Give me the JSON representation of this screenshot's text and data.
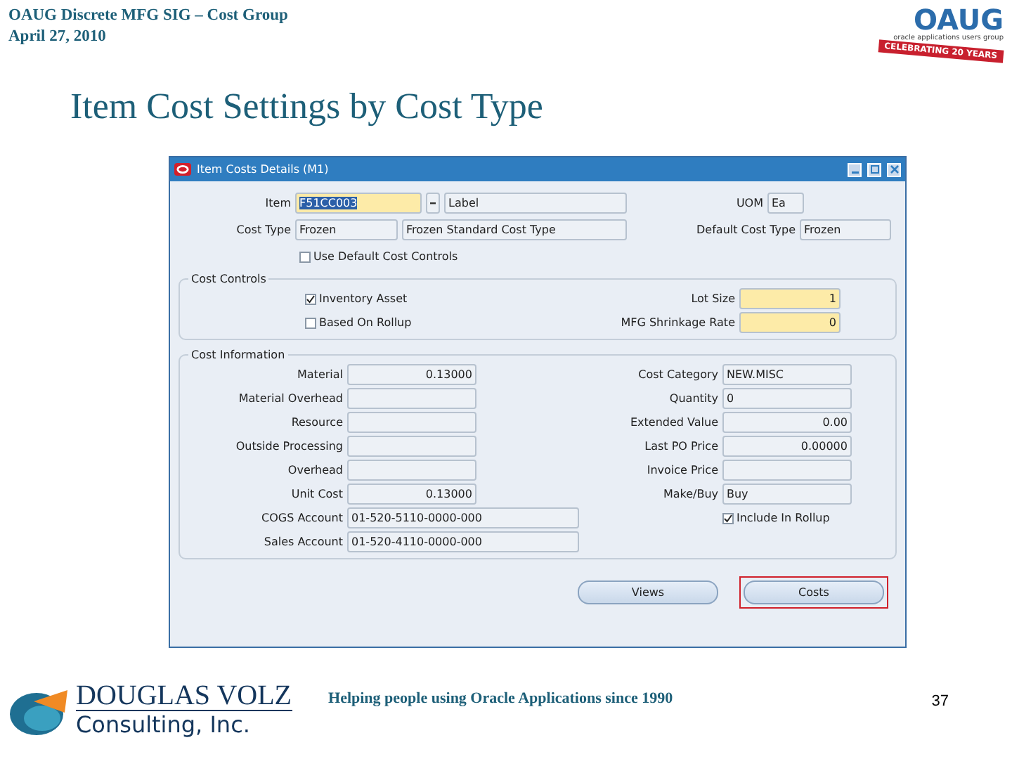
{
  "slide_header": {
    "line": "OAUG Discrete MFG SIG – Cost Group",
    "date": "April 27, 2010"
  },
  "oaug_logo": {
    "name": "OAUG",
    "tagline": "oracle applications users group",
    "banner": "CELEBRATING 20 YEARS"
  },
  "slide_title": "Item Cost Settings by Cost Type",
  "window": {
    "title": "Item Costs Details (M1)",
    "item": {
      "label": "Item",
      "value": "F51CC003",
      "required": true,
      "text_selected": true,
      "description": "Label"
    },
    "uom": {
      "label": "UOM",
      "value": "Ea"
    },
    "cost_type": {
      "label": "Cost Type",
      "value": "Frozen",
      "description": "Frozen Standard Cost Type"
    },
    "default_cost_type": {
      "label": "Default Cost Type",
      "value": "Frozen"
    },
    "use_default_controls": {
      "label": "Use Default Cost Controls",
      "checked": false
    },
    "cost_controls": {
      "title": "Cost Controls",
      "checkboxes": [
        {
          "label": "Inventory Asset",
          "checked": true
        },
        {
          "label": "Based On Rollup",
          "checked": false
        }
      ],
      "fields": [
        {
          "label": "Lot Size",
          "value": "1",
          "required": true
        },
        {
          "label": "MFG Shrinkage Rate",
          "value": "0",
          "required": true
        }
      ]
    },
    "cost_information": {
      "title": "Cost Information",
      "left_fields": [
        {
          "label": "Material",
          "value": "0.13000",
          "kind": "number"
        },
        {
          "label": "Material Overhead",
          "kind": "number"
        },
        {
          "label": "Resource",
          "kind": "number"
        },
        {
          "label": "Outside Processing",
          "kind": "number"
        },
        {
          "label": "Overhead",
          "kind": "number"
        },
        {
          "label": "Unit Cost",
          "value": "0.13000",
          "kind": "number"
        },
        {
          "label": "COGS Account",
          "value": "01-520-5110-0000-000",
          "kind": "account"
        },
        {
          "label": "Sales Account",
          "value": "01-520-4110-0000-000",
          "kind": "account"
        }
      ],
      "right_fields": [
        {
          "label": "Cost Category",
          "value": "NEW.MISC",
          "kind": "text"
        },
        {
          "label": "Quantity",
          "value": "0",
          "kind": "text"
        },
        {
          "label": "Extended Value",
          "value": "0.00",
          "kind": "number"
        },
        {
          "label": "Last PO Price",
          "value": "0.00000",
          "kind": "number"
        },
        {
          "label": "Invoice Price",
          "kind": "number"
        },
        {
          "label": "Make/Buy",
          "value": "Buy",
          "kind": "text"
        }
      ],
      "include_rollup": {
        "label": "Include In Rollup",
        "checked": true
      }
    },
    "buttons": [
      {
        "label": "Views",
        "highlighted": false
      },
      {
        "label": "Costs",
        "highlighted": true
      }
    ]
  },
  "footer": {
    "company": "DOUGLAS VOLZ",
    "company_sub": "Consulting, Inc.",
    "slogan": "Helping people using Oracle Applications since 1990",
    "page": "37"
  }
}
